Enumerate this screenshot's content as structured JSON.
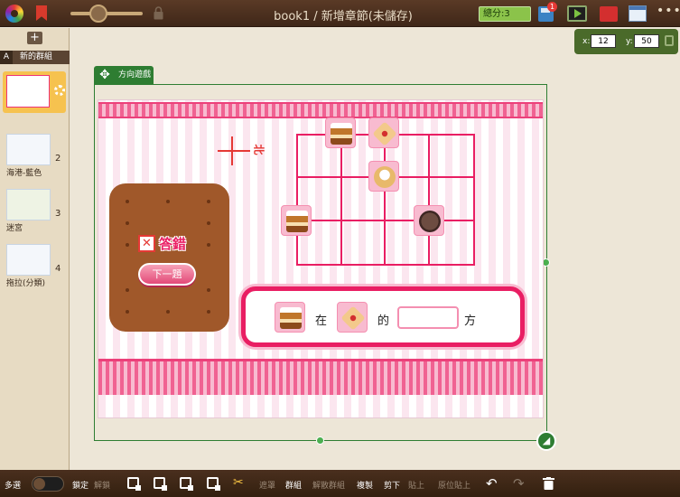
{
  "app": {
    "title": "book1 / 新增章節(未儲存)",
    "score_label": "總分:3",
    "save_badge": "1",
    "more": "•••"
  },
  "sidebar": {
    "add_label": "+",
    "group": {
      "letter": "A",
      "name": "新的群組"
    },
    "pages": [
      {
        "number": "",
        "label": ""
      },
      {
        "number": "2",
        "label": "海港-藍色"
      },
      {
        "number": "3",
        "label": "迷宮"
      },
      {
        "number": "4",
        "label": "拖拉(分類)"
      }
    ]
  },
  "coords": {
    "x_label": "x:",
    "x_value": "12",
    "y_label": "y:",
    "y_value": "50"
  },
  "object_tag": "方向遊戲",
  "game": {
    "compass_label": "北",
    "wrong_mark": "✕",
    "wrong_label": "答錯",
    "next_button": "下一題",
    "sentence_in": "在",
    "sentence_of": "的",
    "sentence_direction": "方",
    "answer_value": ""
  },
  "toolbar": {
    "multi_select": "多選",
    "lock": "鎖定",
    "unlock": "解鎖",
    "mask": "遮罩",
    "group": "群組",
    "ungroup": "解散群組",
    "copy": "複製",
    "cut": "剪下",
    "paste": "貼上",
    "paste_in_place": "原位貼上"
  },
  "colors": {
    "accent_green": "#2e7d32",
    "pink": "#e91e63",
    "topbar": "#3f2718"
  }
}
